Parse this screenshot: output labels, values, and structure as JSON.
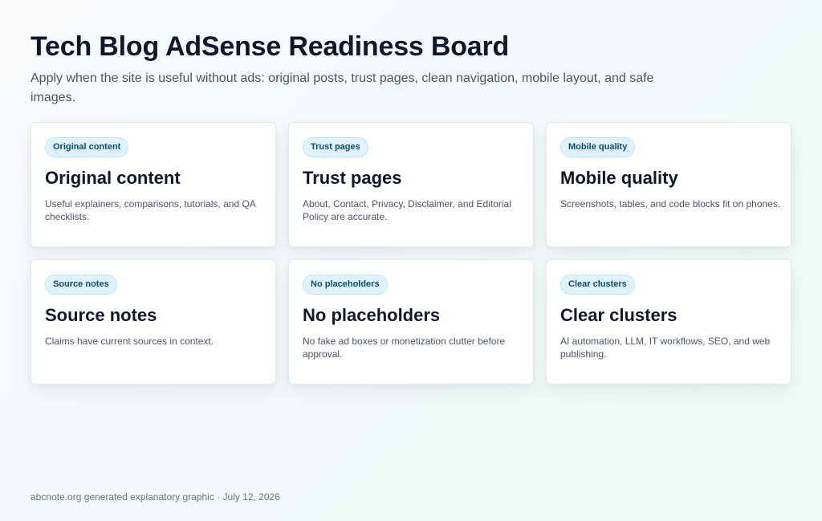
{
  "header": {
    "title": "Tech Blog AdSense Readiness Board",
    "subtitle": "Apply when the site is useful without ads: original posts, trust pages, clean navigation, mobile layout, and safe images."
  },
  "cards": [
    {
      "badge": "Original content",
      "title": "Original content",
      "description": "Useful explainers, comparisons, tutorials, and QA checklists."
    },
    {
      "badge": "Trust pages",
      "title": "Trust pages",
      "description": "About, Contact, Privacy, Disclaimer, and Editorial Policy are accurate."
    },
    {
      "badge": "Mobile quality",
      "title": "Mobile quality",
      "description": "Screenshots, tables, and code blocks fit on phones."
    },
    {
      "badge": "Source notes",
      "title": "Source notes",
      "description": "Claims have current sources in context."
    },
    {
      "badge": "No placeholders",
      "title": "No placeholders",
      "description": "No fake ad boxes or monetization clutter before approval."
    },
    {
      "badge": "Clear clusters",
      "title": "Clear clusters",
      "description": "AI automation, LLM, IT workflows, SEO, and web publishing."
    }
  ],
  "footer": {
    "text": "abcnote.org generated explanatory graphic · July 12, 2026"
  },
  "colors": {
    "badge_background": "#e0f2fe",
    "badge_text": "#0c4a6e",
    "title_text": "#0f172a",
    "body_text": "#475569"
  }
}
